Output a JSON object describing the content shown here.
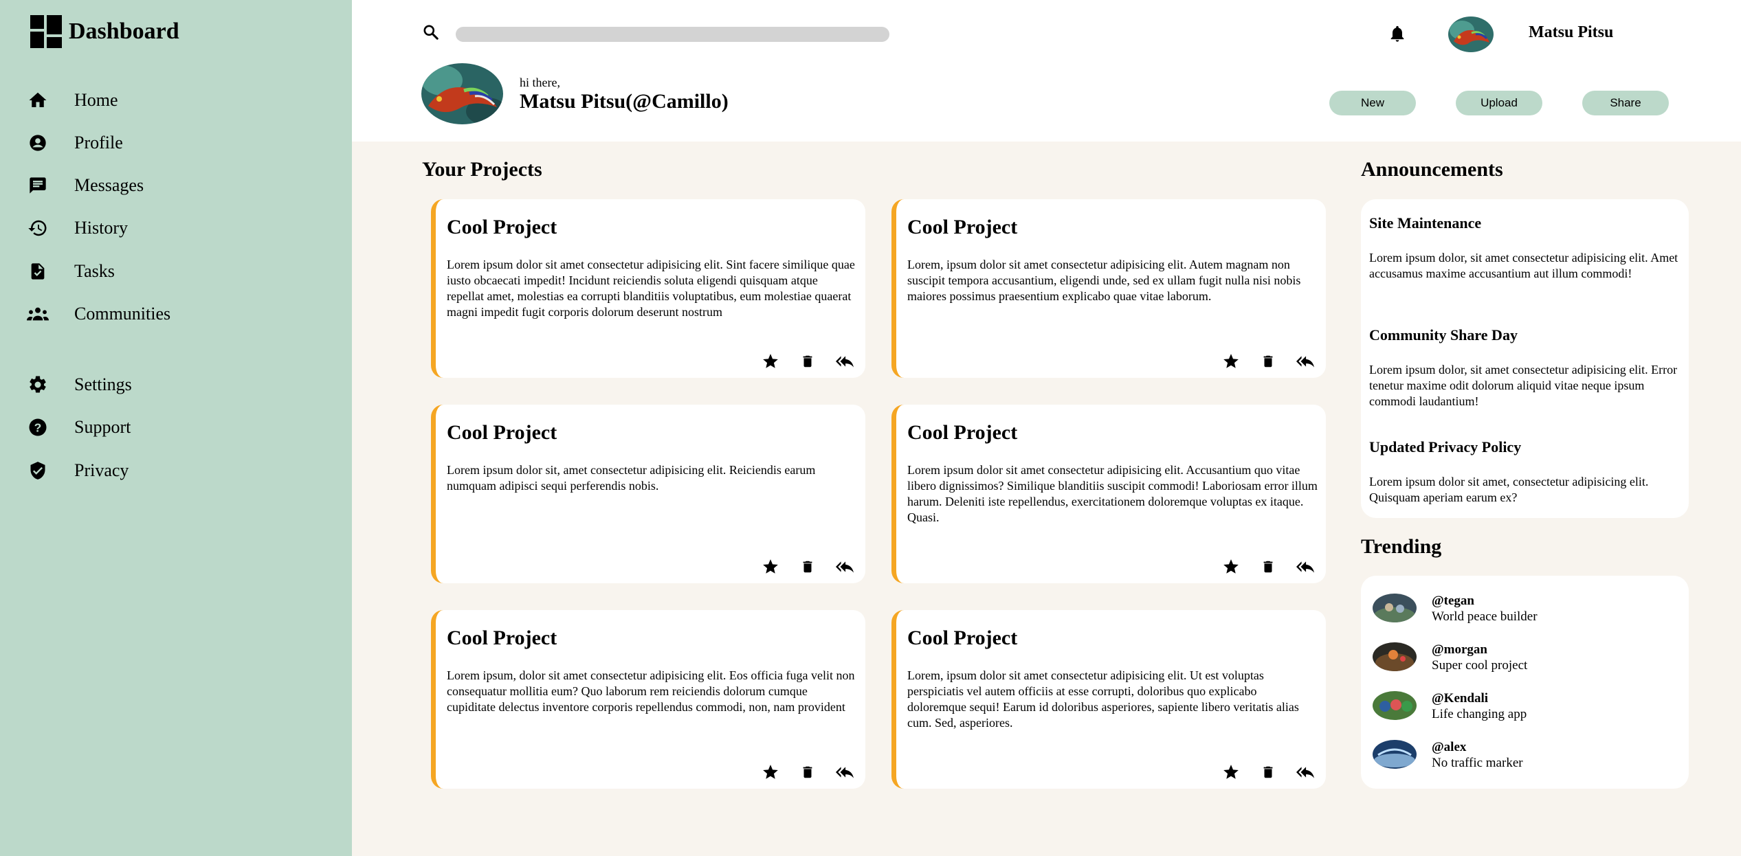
{
  "sidebar": {
    "brand_title": "Dashboard",
    "nav_primary": [
      {
        "label": "Home",
        "icon": "home-icon"
      },
      {
        "label": "Profile",
        "icon": "profile-icon"
      },
      {
        "label": "Messages",
        "icon": "messages-icon"
      },
      {
        "label": "History",
        "icon": "history-icon"
      },
      {
        "label": "Tasks",
        "icon": "tasks-icon"
      },
      {
        "label": "Communities",
        "icon": "communities-icon"
      }
    ],
    "nav_secondary": [
      {
        "label": "Settings",
        "icon": "settings-icon"
      },
      {
        "label": "Support",
        "icon": "support-icon"
      },
      {
        "label": "Privacy",
        "icon": "privacy-icon"
      }
    ],
    "background_color": "#bcd9ca"
  },
  "header": {
    "search": {
      "value": "",
      "placeholder": ""
    },
    "username": "Matsu Pitsu",
    "greeting": "hi there,",
    "fullname": "Matsu Pitsu(@Camillo)",
    "buttons": {
      "new": "New",
      "upload": "Upload",
      "share": "Share"
    }
  },
  "projects": {
    "title": "Your Projects",
    "accent_color": "#f5a623",
    "cards": [
      {
        "title": "Cool Project",
        "body": "Lorem ipsum dolor sit amet consectetur adipisicing elit. Sint facere similique quae iusto obcaecati impedit! Incidunt reiciendis soluta eligendi quisquam atque repellat amet, molestias ea corrupti blanditiis voluptatibus, eum molestiae quaerat magni impedit fugit corporis dolorum deserunt nostrum"
      },
      {
        "title": "Cool Project",
        "body": "Lorem, ipsum dolor sit amet consectetur adipisicing elit. Autem magnam non suscipit tempora accusantium, eligendi unde, sed ex ullam fugit nulla nisi nobis maiores possimus praesentium explicabo quae vitae laborum."
      },
      {
        "title": "Cool Project",
        "body": "Lorem ipsum dolor sit, amet consectetur adipisicing elit. Reiciendis earum numquam adipisci sequi perferendis nobis."
      },
      {
        "title": "Cool Project",
        "body": "Lorem ipsum dolor sit amet consectetur adipisicing elit. Accusantium quo vitae libero dignissimos? Similique blanditiis suscipit commodi! Laboriosam error illum harum. Deleniti iste repellendus, exercitationem doloremque voluptas ex itaque. Quasi."
      },
      {
        "title": "Cool Project",
        "body": "Lorem ipsum, dolor sit amet consectetur adipisicing elit. Eos officia fuga velit non consequatur mollitia eum? Quo laborum rem reiciendis dolorum cumque cupiditate delectus inventore corporis repellendus commodi, non, nam provident"
      },
      {
        "title": "Cool Project",
        "body": "Lorem, ipsum dolor sit amet consectetur adipisicing elit. Ut est voluptas perspiciatis vel autem officiis at esse corrupti, doloribus quo explicabo doloremque sequi! Earum id doloribus asperiores, sapiente libero veritatis alias cum. Sed, asperiores."
      }
    ],
    "card_actions": [
      "star-icon",
      "trash-icon",
      "reply-all-icon"
    ]
  },
  "announcements": {
    "title": "Announcements",
    "items": [
      {
        "title": "Site Maintenance",
        "body": "Lorem ipsum dolor, sit amet consectetur adipisicing elit. Amet accusamus maxime accusantium aut illum commodi!"
      },
      {
        "title": "Community Share Day",
        "body": "Lorem ipsum dolor, sit amet consectetur adipisicing elit. Error tenetur maxime odit dolorum aliquid vitae neque ipsum commodi laudantium!"
      },
      {
        "title": "Updated Privacy Policy",
        "body": "Lorem ipsum dolor sit amet, consectetur adipisicing elit. Quisquam aperiam earum ex?"
      }
    ]
  },
  "trending": {
    "title": "Trending",
    "items": [
      {
        "handle": "@tegan",
        "description": "World peace builder"
      },
      {
        "handle": "@morgan",
        "description": "Super cool project"
      },
      {
        "handle": "@Kendali",
        "description": "Life changing app"
      },
      {
        "handle": "@alex",
        "description": "No traffic marker"
      }
    ]
  }
}
